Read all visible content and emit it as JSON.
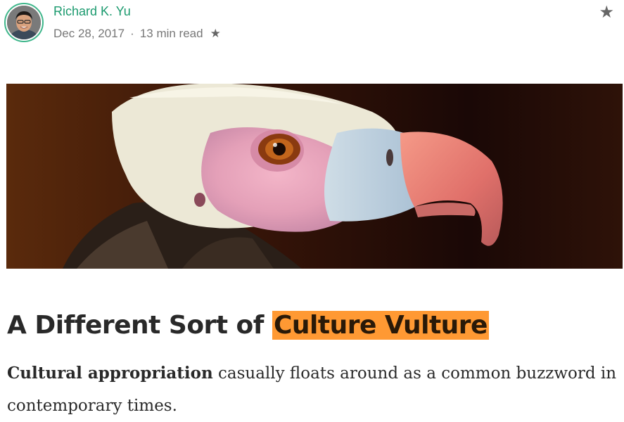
{
  "author": {
    "name": "Richard K. Yu",
    "date": "Dec 28, 2017",
    "separator": "·",
    "read_time": "13 min read",
    "member_star": "★"
  },
  "bookmark_icon": "★",
  "article": {
    "title_prefix": "A Different Sort of ",
    "title_highlight": "Culture Vulture",
    "lede_bold": "Cultural appropriation",
    "lede_rest": " casually floats around as a common buzzword in contemporary times."
  },
  "colors": {
    "author_green": "#1b9a6e",
    "highlight": "#ff9933"
  }
}
